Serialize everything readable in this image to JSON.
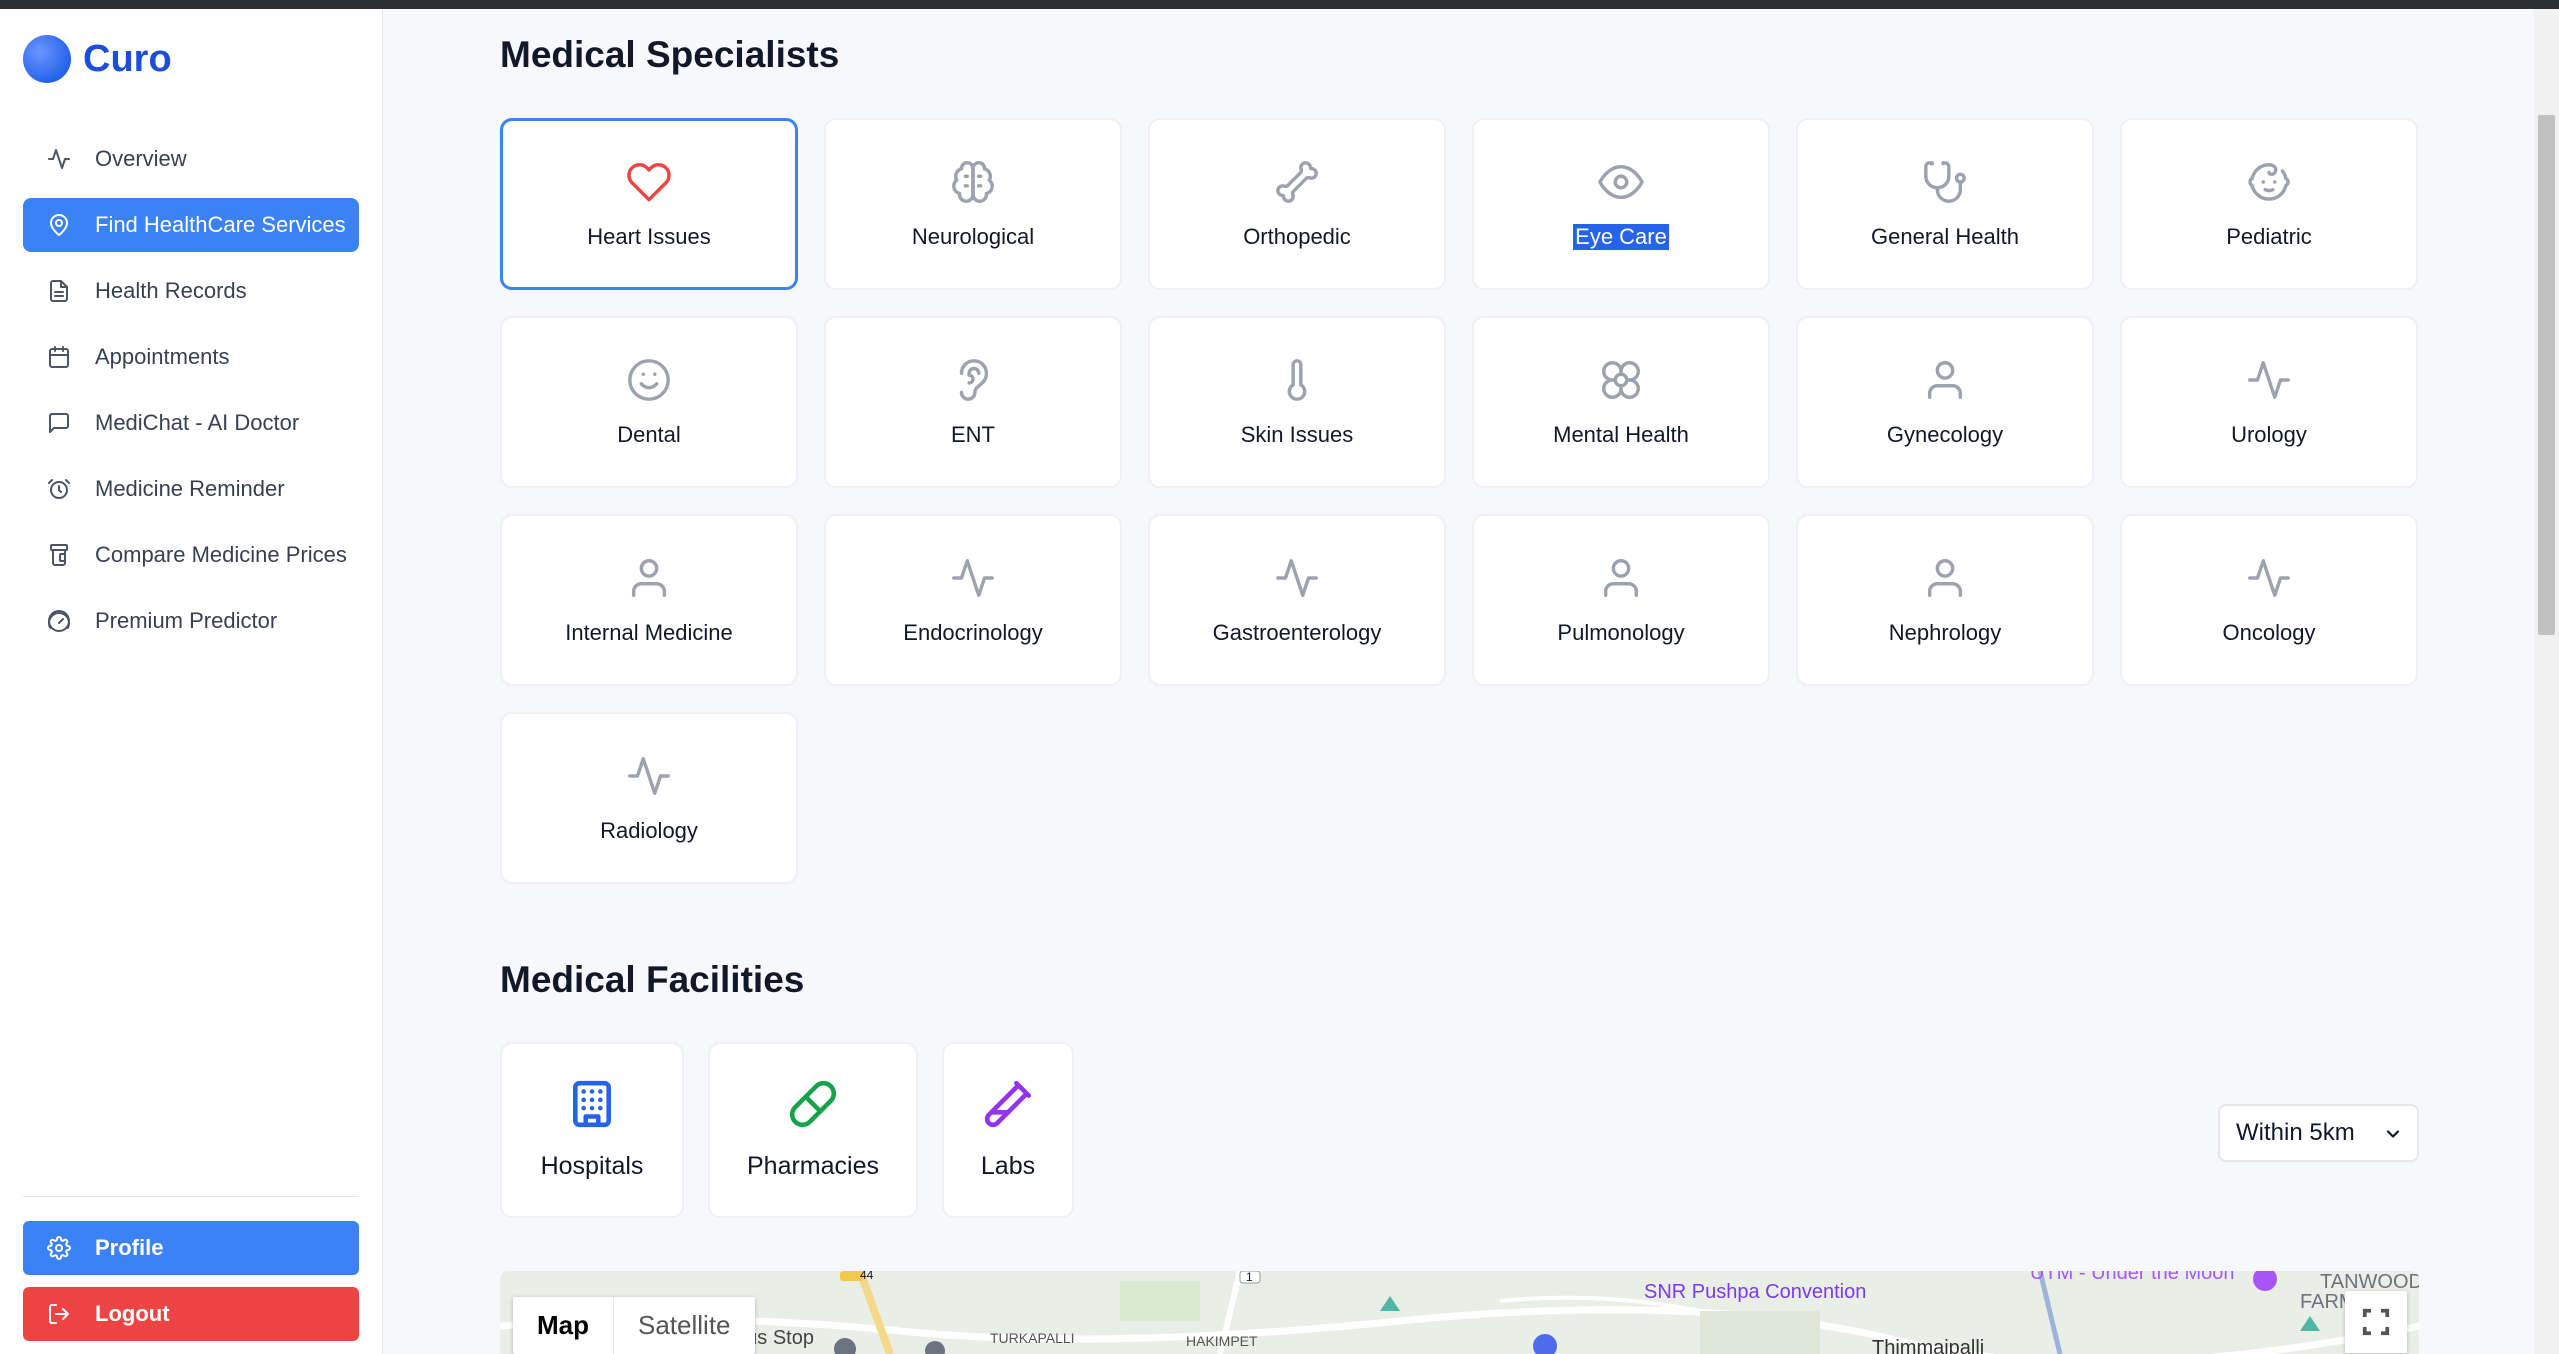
{
  "app": {
    "name": "Curo"
  },
  "sidebar": {
    "items": [
      {
        "label": "Overview",
        "icon": "activity-icon",
        "active": false
      },
      {
        "label": "Find HealthCare Services",
        "icon": "map-pin-icon",
        "active": true
      },
      {
        "label": "Health Records",
        "icon": "file-text-icon",
        "active": false
      },
      {
        "label": "Appointments",
        "icon": "calendar-icon",
        "active": false
      },
      {
        "label": "MediChat - AI Doctor",
        "icon": "message-square-icon",
        "active": false
      },
      {
        "label": "Medicine Reminder",
        "icon": "alarm-clock-icon",
        "active": false
      },
      {
        "label": "Compare Medicine Prices",
        "icon": "pill-bottle-icon",
        "active": false
      },
      {
        "label": "Premium Predictor",
        "icon": "gauge-icon",
        "active": false
      }
    ],
    "profile_label": "Profile",
    "logout_label": "Logout"
  },
  "specialists": {
    "title": "Medical Specialists",
    "items": [
      {
        "label": "Heart Issues",
        "icon": "heart-icon",
        "selected": true
      },
      {
        "label": "Neurological",
        "icon": "brain-icon"
      },
      {
        "label": "Orthopedic",
        "icon": "bone-icon"
      },
      {
        "label": "Eye Care",
        "icon": "eye-icon",
        "text_selected": true
      },
      {
        "label": "General Health",
        "icon": "stethoscope-icon"
      },
      {
        "label": "Pediatric",
        "icon": "baby-icon"
      },
      {
        "label": "Dental",
        "icon": "smile-icon"
      },
      {
        "label": "ENT",
        "icon": "ear-icon"
      },
      {
        "label": "Skin Issues",
        "icon": "thermometer-icon"
      },
      {
        "label": "Mental Health",
        "icon": "flower-icon"
      },
      {
        "label": "Gynecology",
        "icon": "user-icon"
      },
      {
        "label": "Urology",
        "icon": "activity-icon"
      },
      {
        "label": "Internal Medicine",
        "icon": "user-icon"
      },
      {
        "label": "Endocrinology",
        "icon": "activity-icon"
      },
      {
        "label": "Gastroenterology",
        "icon": "activity-icon"
      },
      {
        "label": "Pulmonology",
        "icon": "user-icon"
      },
      {
        "label": "Nephrology",
        "icon": "user-icon"
      },
      {
        "label": "Oncology",
        "icon": "activity-icon"
      },
      {
        "label": "Radiology",
        "icon": "activity-icon"
      }
    ]
  },
  "facilities": {
    "title": "Medical Facilities",
    "items": [
      {
        "label": "Hospitals",
        "icon": "building-icon",
        "color": "#2563eb"
      },
      {
        "label": "Pharmacies",
        "icon": "pill-icon",
        "color": "#16a34a"
      },
      {
        "label": "Labs",
        "icon": "test-tube-icon",
        "color": "#9333ea"
      }
    ],
    "distance_selected": "Within 5km"
  },
  "map": {
    "map_tab": "Map",
    "satellite_tab": "Satellite",
    "labels": {
      "snr": "SNR Pushpa Convention",
      "turkapalli": "TURKAPALLI",
      "hakimpet": "HAKIMPET",
      "thimmaipalli": "Thimmaipalli",
      "bus_stop": "Kompally Bus Stop",
      "tanwood": "TANWOOD",
      "farm": "FARM",
      "utm": "UTM - Under the Moon",
      "road_44": "44",
      "road_1": "1"
    }
  },
  "colors": {
    "primary": "#3b82f6",
    "danger": "#ef4444",
    "brand": "#1d4ed8"
  }
}
